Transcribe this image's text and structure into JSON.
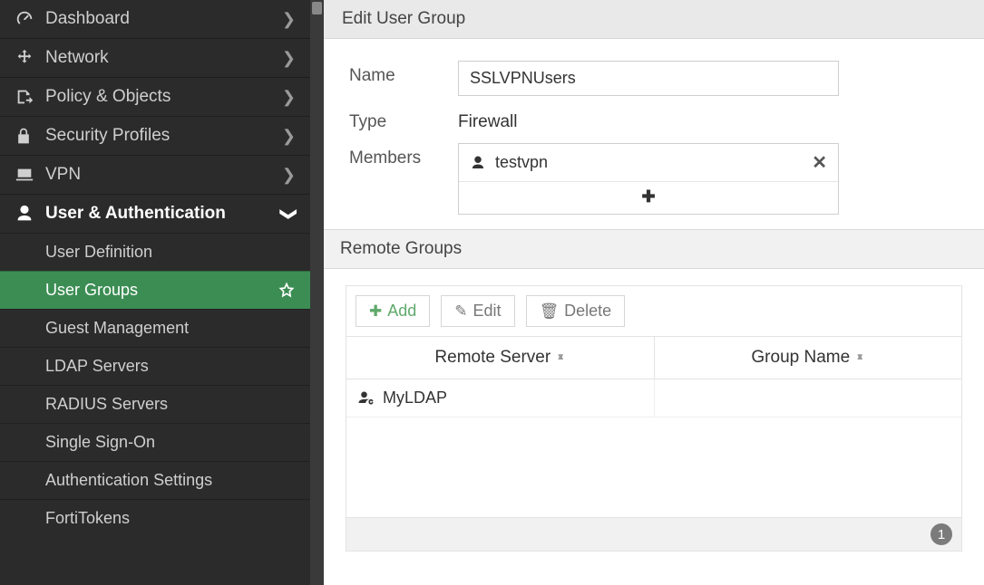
{
  "sidebar": {
    "items": [
      {
        "label": "Dashboard",
        "icon": "gauge-icon",
        "chevron": "right"
      },
      {
        "label": "Network",
        "icon": "move-icon",
        "chevron": "right"
      },
      {
        "label": "Policy & Objects",
        "icon": "policy-icon",
        "chevron": "right"
      },
      {
        "label": "Security Profiles",
        "icon": "lock-icon",
        "chevron": "right"
      },
      {
        "label": "VPN",
        "icon": "laptop-icon",
        "chevron": "right"
      },
      {
        "label": "User & Authentication",
        "icon": "user-icon",
        "chevron": "down",
        "expanded": true
      }
    ],
    "subitems": [
      {
        "label": "User Definition"
      },
      {
        "label": "User Groups",
        "active": true
      },
      {
        "label": "Guest Management"
      },
      {
        "label": "LDAP Servers"
      },
      {
        "label": "RADIUS Servers"
      },
      {
        "label": "Single Sign-On"
      },
      {
        "label": "Authentication Settings"
      },
      {
        "label": "FortiTokens"
      }
    ]
  },
  "page": {
    "title": "Edit User Group",
    "form": {
      "name_label": "Name",
      "name_value": "SSLVPNUsers",
      "type_label": "Type",
      "type_value": "Firewall",
      "members_label": "Members",
      "members": [
        {
          "label": "testvpn"
        }
      ]
    },
    "remote_groups": {
      "header": "Remote Groups",
      "buttons": {
        "add": "Add",
        "edit": "Edit",
        "delete": "Delete"
      },
      "columns": {
        "server": "Remote Server",
        "group": "Group Name"
      },
      "rows": [
        {
          "server": "MyLDAP",
          "group": ""
        }
      ],
      "count": "1"
    }
  }
}
